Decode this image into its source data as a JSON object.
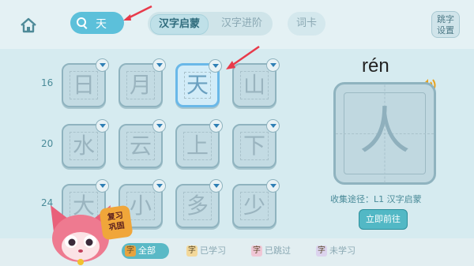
{
  "search": {
    "query": "天"
  },
  "tabs": [
    {
      "label": "汉字启蒙",
      "active": true
    },
    {
      "label": "汉字进阶",
      "active": false
    },
    {
      "label": "词卡",
      "active": false
    }
  ],
  "skip_settings": {
    "line1": "跳字",
    "line2": "设置"
  },
  "grid": {
    "rows": [
      {
        "number": "16",
        "chars": [
          "日",
          "月",
          "天",
          "山"
        ]
      },
      {
        "number": "20",
        "chars": [
          "水",
          "云",
          "上",
          "下"
        ]
      },
      {
        "number": "24",
        "chars": [
          "大",
          "小",
          "多",
          "少"
        ]
      }
    ],
    "selected_char": "天"
  },
  "detail": {
    "pinyin": "rén",
    "char": "人",
    "source": "收集途径：L1 汉字启蒙",
    "go_button": "立即前往"
  },
  "filters": [
    {
      "mark": "字",
      "label": "全部",
      "active": true
    },
    {
      "mark": "字",
      "label": "已学习",
      "active": false
    },
    {
      "mark": "字",
      "label": "已跳过",
      "active": false
    },
    {
      "mark": "字",
      "label": "未学习",
      "active": false
    }
  ],
  "badge": {
    "line1": "复习",
    "line2": "巩固"
  },
  "colors": {
    "accent": "#5cc0da",
    "selected_border": "#6ab8e8",
    "annotation_arrow": "#e83a4a",
    "badge": "#f0a63a"
  }
}
